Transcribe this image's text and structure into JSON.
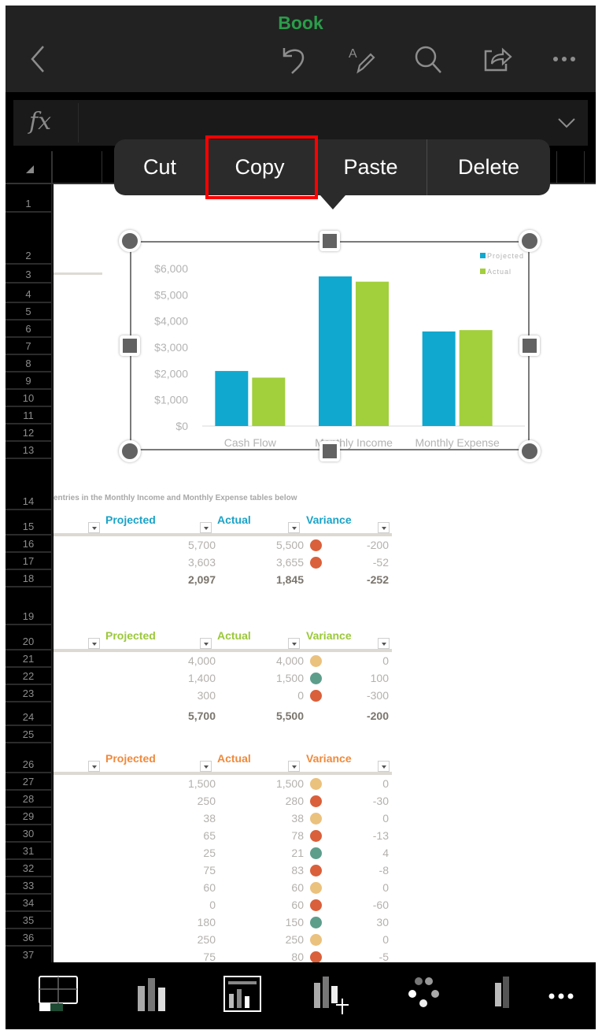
{
  "app": {
    "title": "Book",
    "title_color": "#2a9d49"
  },
  "toolbar": {
    "icons": [
      "back-icon",
      "undo-icon",
      "draw-icon",
      "search-icon",
      "share-icon",
      "more-icon"
    ]
  },
  "formula_bar": {
    "label": "fx",
    "value": ""
  },
  "context_menu": {
    "items": [
      "Cut",
      "Copy",
      "Paste",
      "Delete"
    ],
    "highlighted": "Copy"
  },
  "row_headers": [
    "1",
    "2",
    "3",
    "4",
    "5",
    "6",
    "7",
    "8",
    "9",
    "10",
    "11",
    "12",
    "13",
    "14",
    "15",
    "16",
    "17",
    "18",
    "19",
    "20",
    "21",
    "22",
    "23",
    "24",
    "25",
    "26",
    "27",
    "28",
    "29",
    "30",
    "31",
    "32",
    "33",
    "34",
    "35",
    "36",
    "37"
  ],
  "chart_data": {
    "type": "bar",
    "title": "",
    "categories": [
      "Cash Flow",
      "Monthly Income",
      "Monthly Expense"
    ],
    "series": [
      {
        "name": "Projected",
        "color": "#10a8cf",
        "values": [
          2097,
          5700,
          3603
        ]
      },
      {
        "name": "Actual",
        "color": "#a2cf3c",
        "values": [
          1845,
          5500,
          3655
        ]
      }
    ],
    "ylim": [
      0,
      6000
    ],
    "yticks": [
      "$0",
      "$1,000",
      "$2,000",
      "$3,000",
      "$4,000",
      "$5,000",
      "$6,000"
    ],
    "xlabel": "",
    "ylabel": "",
    "legend": "top-right",
    "grid": false
  },
  "hint_text": "entries in the Monthly Income and Monthly Expense tables below",
  "status_colors": {
    "negative": "#d9603b",
    "neutral": "#ebc17e",
    "positive": "#5d9e8b"
  },
  "tables": [
    {
      "header_color": "#1aa3c8",
      "headers": {
        "projected": "Projected",
        "actual": "Actual",
        "variance": "Variance"
      },
      "rows": [
        {
          "projected": "5,700",
          "actual": "5,500",
          "status": "negative",
          "variance": "-200"
        },
        {
          "projected": "3,603",
          "actual": "3,655",
          "status": "negative",
          "variance": "-52"
        },
        {
          "projected": "2,097",
          "actual": "1,845",
          "status": "",
          "variance": "-252",
          "total": true
        }
      ]
    },
    {
      "header_color": "#9bc83a",
      "headers": {
        "projected": "Projected",
        "actual": "Actual",
        "variance": "Variance"
      },
      "rows": [
        {
          "projected": "4,000",
          "actual": "4,000",
          "status": "neutral",
          "variance": "0"
        },
        {
          "projected": "1,400",
          "actual": "1,500",
          "status": "positive",
          "variance": "100"
        },
        {
          "projected": "300",
          "actual": "0",
          "status": "negative",
          "variance": "-300"
        },
        {
          "projected": "5,700",
          "actual": "5,500",
          "status": "",
          "variance": "-200",
          "total": true
        }
      ]
    },
    {
      "header_color": "#ef8a3c",
      "headers": {
        "projected": "Projected",
        "actual": "Actual",
        "variance": "Variance"
      },
      "rows": [
        {
          "projected": "1,500",
          "actual": "1,500",
          "status": "neutral",
          "variance": "0"
        },
        {
          "projected": "250",
          "actual": "280",
          "status": "negative",
          "variance": "-30"
        },
        {
          "projected": "38",
          "actual": "38",
          "status": "neutral",
          "variance": "0"
        },
        {
          "projected": "65",
          "actual": "78",
          "status": "negative",
          "variance": "-13"
        },
        {
          "projected": "25",
          "actual": "21",
          "status": "positive",
          "variance": "4"
        },
        {
          "projected": "75",
          "actual": "83",
          "status": "negative",
          "variance": "-8"
        },
        {
          "projected": "60",
          "actual": "60",
          "status": "neutral",
          "variance": "0"
        },
        {
          "projected": "0",
          "actual": "60",
          "status": "negative",
          "variance": "-60"
        },
        {
          "projected": "180",
          "actual": "150",
          "status": "positive",
          "variance": "30"
        },
        {
          "projected": "250",
          "actual": "250",
          "status": "neutral",
          "variance": "0"
        },
        {
          "projected": "75",
          "actual": "80",
          "status": "negative",
          "variance": "-5"
        }
      ]
    }
  ],
  "bottom_toolbar": {
    "icons": [
      "sheet-grid-icon",
      "chart-icon",
      "chart-layout-icon",
      "add-chart-element-icon",
      "chart-styles-icon",
      "chart-colors-icon",
      "more-icon"
    ]
  }
}
